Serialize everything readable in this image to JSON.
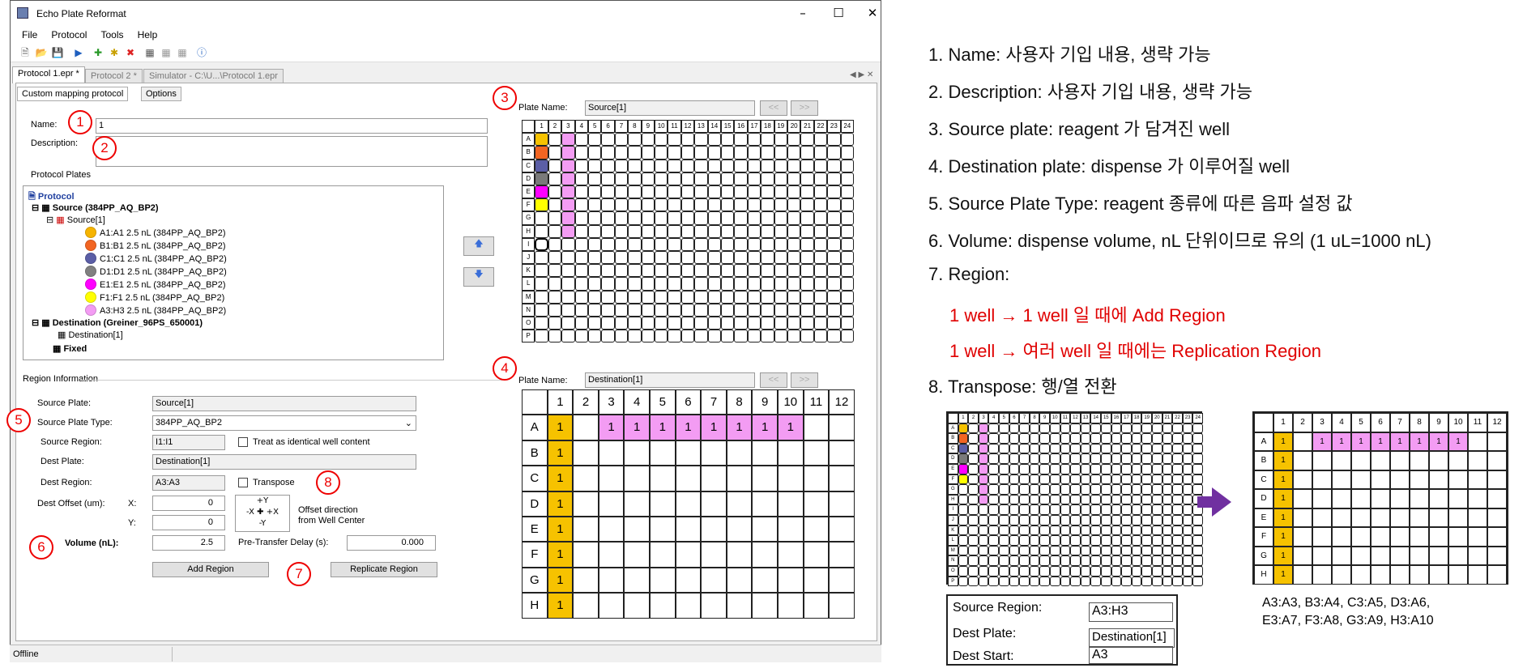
{
  "window": {
    "title": "Echo Plate Reformat"
  },
  "menu": [
    "File",
    "Protocol",
    "Tools",
    "Help"
  ],
  "tabs": [
    "Protocol 1.epr *",
    "Protocol 2 *",
    "Simulator - C:\\U...\\Protocol 1.epr"
  ],
  "subtabs": [
    "Custom mapping protocol",
    "Options"
  ],
  "form": {
    "name_label": "Name:",
    "name_value": "1",
    "description_label": "Description:",
    "protocol_plates_label": "Protocol Plates",
    "region_info_label": "Region Information",
    "source_plate_label": "Source Plate:",
    "source_plate_value": "Source[1]",
    "source_type_label": "Source Plate Type:",
    "source_type_value": "384PP_AQ_BP2",
    "source_region_label": "Source Region:",
    "source_region_value": "I1:I1",
    "identical_label": "Treat as identical well content",
    "dest_plate_label": "Dest Plate:",
    "dest_plate_value": "Destination[1]",
    "dest_region_label": "Dest Region:",
    "dest_region_value": "A3:A3",
    "transpose_label": "Transpose",
    "dest_offset_label": "Dest Offset (um):",
    "x_label": "X:",
    "x_value": "0",
    "y_label": "Y:",
    "y_value": "0",
    "offset_note_1": "Offset direction",
    "offset_note_2": "from Well Center",
    "volume_label": "Volume (nL):",
    "volume_value": "2.5",
    "delay_label": "Pre-Transfer Delay (s):",
    "delay_value": "0.000",
    "add_region": "Add Region",
    "replicate_region": "Replicate Region"
  },
  "tree": {
    "root": "Protocol",
    "source": "Source   (384PP_AQ_BP2)",
    "source1": "Source[1]",
    "wells": [
      {
        "label": "A1:A1 2.5 nL (384PP_AQ_BP2)",
        "color": "#f6b400"
      },
      {
        "label": "B1:B1 2.5 nL (384PP_AQ_BP2)",
        "color": "#f26522"
      },
      {
        "label": "C1:C1 2.5 nL (384PP_AQ_BP2)",
        "color": "#5b5ea6"
      },
      {
        "label": "D1:D1 2.5 nL (384PP_AQ_BP2)",
        "color": "#808080"
      },
      {
        "label": "E1:E1 2.5 nL (384PP_AQ_BP2)",
        "color": "#ff00ff"
      },
      {
        "label": "F1:F1 2.5 nL (384PP_AQ_BP2)",
        "color": "#ffff00"
      },
      {
        "label": "A3:H3 2.5 nL (384PP_AQ_BP2)",
        "color": "#f39cf3"
      }
    ],
    "destination": "Destination   (Greiner_96PS_650001)",
    "destination1": "Destination[1]",
    "fixed": "Fixed"
  },
  "source_plate": {
    "label": "Plate Name:",
    "value": "Source[1]",
    "rows": [
      "A",
      "B",
      "C",
      "D",
      "E",
      "F",
      "G",
      "H",
      "I",
      "J",
      "K",
      "L",
      "M",
      "N",
      "O",
      "P"
    ],
    "cols": 24
  },
  "dest_plate": {
    "label": "Plate Name:",
    "value": "Destination[1]",
    "rows": [
      "A",
      "B",
      "C",
      "D",
      "E",
      "F",
      "G",
      "H"
    ],
    "cols": 12,
    "value_text": "1"
  },
  "nav": {
    "prev": "<<",
    "next": ">>"
  },
  "status": "Offline",
  "markers": [
    "1",
    "2",
    "3",
    "4",
    "5",
    "6",
    "7",
    "8"
  ],
  "notes": [
    "1. Name: 사용자 기입 내용, 생략 가능",
    "2. Description: 사용자 기입 내용, 생략 가능",
    "3. Source plate: reagent 가 담겨진 well",
    "4. Destination plate: dispense 가 이루어질 well",
    "5. Source Plate Type: reagent 종류에 따른 음파 설정 값",
    "6. Volume: dispense volume, nL 단위이므로 유의 (1 uL=1000 nL)",
    "7. Region:",
    "1 well → 1 well 일 때에 Add Region",
    "1 well → 여러 well 일 때에는 Replication Region",
    "8. Transpose: 행/열 전환"
  ],
  "transpose_box": {
    "source_region_label": "Source Region:",
    "source_region_value": "A3:H3",
    "dest_plate_label": "Dest Plate:",
    "dest_plate_value": "Destination[1]",
    "dest_start_label": "Dest Start:",
    "dest_start_value": "A3",
    "mapping_1": "A3:A3,  B3:A4,  C3:A5,  D3:A6,",
    "mapping_2": "E3:A7,  F3:A8,  G3:A9,  H3:A10"
  },
  "colors": {
    "yellow": "#f6c200",
    "pink": "#f39cf3",
    "orange": "#f26522",
    "purple": "#5b5ea6",
    "gray": "#7a7a7a",
    "magenta": "#ff00ff",
    "lemon": "#ffff00",
    "arrow": "#7030a0"
  }
}
